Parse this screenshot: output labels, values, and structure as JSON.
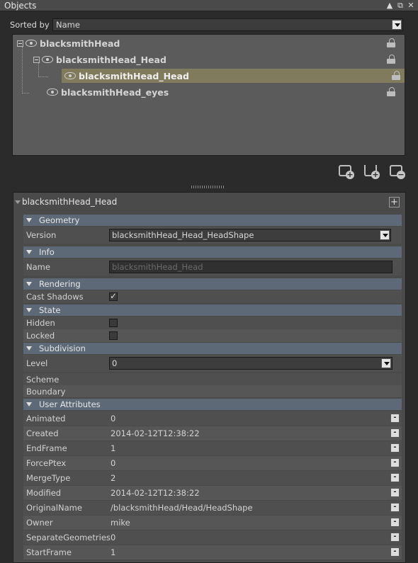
{
  "window": {
    "title": "Objects",
    "controls": [
      "▲",
      "⧉",
      "✕"
    ]
  },
  "sort": {
    "label": "Sorted by",
    "value": "Name"
  },
  "tree": {
    "nodes": [
      {
        "label": "blacksmithHead"
      },
      {
        "label": "blacksmithHead_Head"
      },
      {
        "label": "blacksmithHead_Head"
      },
      {
        "label": "blacksmithHead_eyes"
      }
    ],
    "selected_index": 2
  },
  "toolbar": {
    "icons": [
      "camera-add-icon",
      "locator-add-icon",
      "camera-remove-icon"
    ]
  },
  "props": {
    "title": "blacksmithHead_Head",
    "add_label": "+",
    "sections": {
      "geometry": "Geometry",
      "info": "Info",
      "rendering": "Rendering",
      "state": "State",
      "subdivision": "Subdivision",
      "user_attributes": "User Attributes"
    },
    "geometry": {
      "version_label": "Version",
      "version_value": "blacksmithHead_Head_HeadShape"
    },
    "info": {
      "name_label": "Name",
      "name_value": "blacksmithHead_Head"
    },
    "rendering": {
      "cast_shadows_label": "Cast Shadows",
      "cast_shadows": true
    },
    "state": {
      "hidden_label": "Hidden",
      "hidden": false,
      "locked_label": "Locked",
      "locked": false
    },
    "subdivision": {
      "level_label": "Level",
      "level_value": "0",
      "scheme_label": "Scheme",
      "boundary_label": "Boundary"
    },
    "user_attributes": [
      {
        "key": "Animated",
        "value": "0"
      },
      {
        "key": "Created",
        "value": "2014-02-12T12:38:22"
      },
      {
        "key": "EndFrame",
        "value": "1"
      },
      {
        "key": "ForcePtex",
        "value": "0"
      },
      {
        "key": "MergeType",
        "value": "2"
      },
      {
        "key": "Modified",
        "value": "2014-02-12T12:38:22"
      },
      {
        "key": "OriginalName",
        "value": "/blacksmithHead/Head/HeadShape"
      },
      {
        "key": "Owner",
        "value": "mike"
      },
      {
        "key": "SeparateGeometries",
        "value": "0"
      },
      {
        "key": "StartFrame",
        "value": "1"
      }
    ],
    "remove_label": "-"
  }
}
